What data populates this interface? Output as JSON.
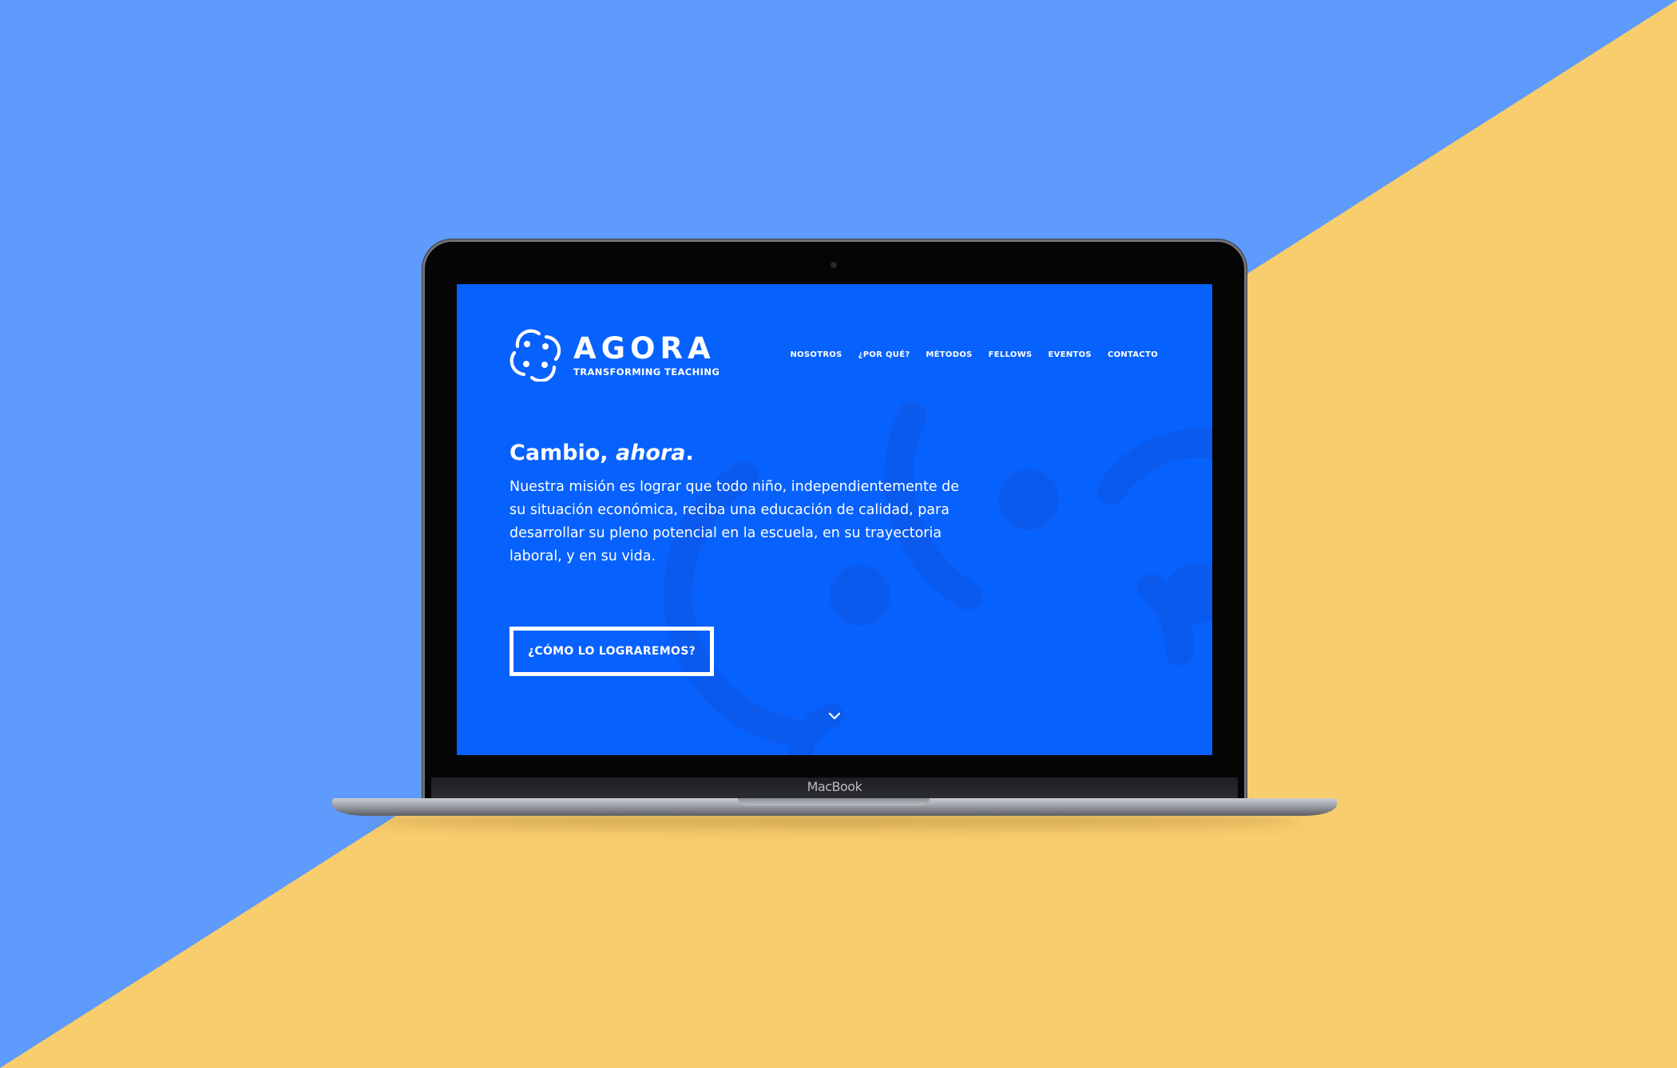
{
  "colors": {
    "background_blue": "#5e9bfd",
    "background_yellow": "#f8cd6d",
    "site_blue": "#0761fd",
    "site_text": "#ffffff"
  },
  "device": {
    "label": "MacBook"
  },
  "site": {
    "brand": {
      "name": "AGORA",
      "tagline": "TRANSFORMING TEACHING",
      "icon": "agora-logo-icon"
    },
    "nav": [
      {
        "label": "NOSOTROS"
      },
      {
        "label": "¿POR QUÉ?"
      },
      {
        "label": "MÉTODOS"
      },
      {
        "label": "FELLOWS"
      },
      {
        "label": "EVENTOS"
      },
      {
        "label": "CONTACTO"
      }
    ],
    "hero": {
      "headline_main": "Cambio,",
      "headline_em": "ahora",
      "headline_end": ".",
      "mission": "Nuestra misión es lograr que todo niño, independientemente de su situación económica, reciba una educación de calidad, para desarrollar su pleno potencial en la escuela, en su trayectoria laboral, y en su vida.",
      "cta_label": "¿CÓMO LO LOGRAREMOS?",
      "scroll_icon": "chevron-down-icon"
    }
  }
}
